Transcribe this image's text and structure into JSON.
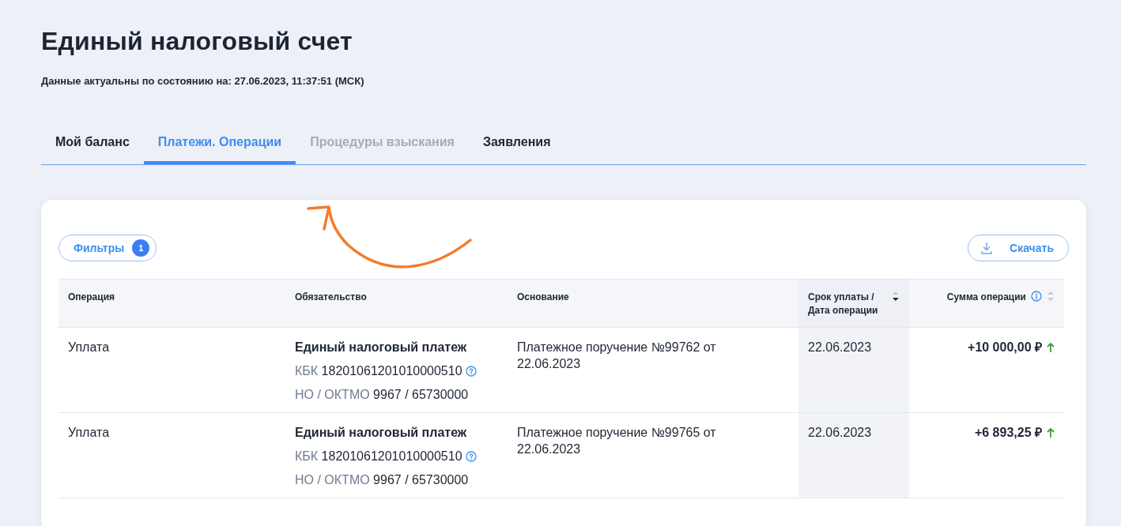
{
  "page": {
    "title": "Единый налоговый счет",
    "updated": "Данные актуальны по состоянию на: 27.06.2023, 11:37:51 (МСК)"
  },
  "tabs": [
    {
      "label": "Мой баланс",
      "selected": false,
      "disabled": false
    },
    {
      "label": "Платежи. Операции",
      "selected": true,
      "disabled": false
    },
    {
      "label": "Процедуры взыскания",
      "selected": false,
      "disabled": true
    },
    {
      "label": "Заявления",
      "selected": false,
      "disabled": false
    }
  ],
  "toolbar": {
    "filters": {
      "label": "Фильтры",
      "count": "1"
    },
    "download": {
      "label": "Скачать"
    }
  },
  "table": {
    "columns": [
      {
        "label": "Операция"
      },
      {
        "label": "Обязательство"
      },
      {
        "label": "Основание"
      },
      {
        "label": "Срок уплаты / Дата операции",
        "sortable": true,
        "sorted": true,
        "info": false
      },
      {
        "label": "Сумма операции",
        "sortable": true,
        "sorted": false,
        "info": true
      }
    ],
    "rows": [
      {
        "operation": "Уплата",
        "obligation": "Единый налоговый платеж",
        "kbk_label": "КБК",
        "kbk": "18201061201010000510",
        "oktmo_label": "НО / ОКТМО",
        "oktmo": "9967 / 65730000",
        "basis": "Платежное поручение №99762 от 22.06.2023",
        "date": "22.06.2023",
        "amount": "+10 000,00 ₽"
      },
      {
        "operation": "Уплата",
        "obligation": "Единый налоговый платеж",
        "kbk_label": "КБК",
        "kbk": "18201061201010000510",
        "oktmo_label": "НО / ОКТМО",
        "oktmo": "9967 / 65730000",
        "basis": "Платежное поручение №99765 от 22.06.2023",
        "date": "22.06.2023",
        "amount": "+6 893,25 ₽"
      }
    ]
  }
}
